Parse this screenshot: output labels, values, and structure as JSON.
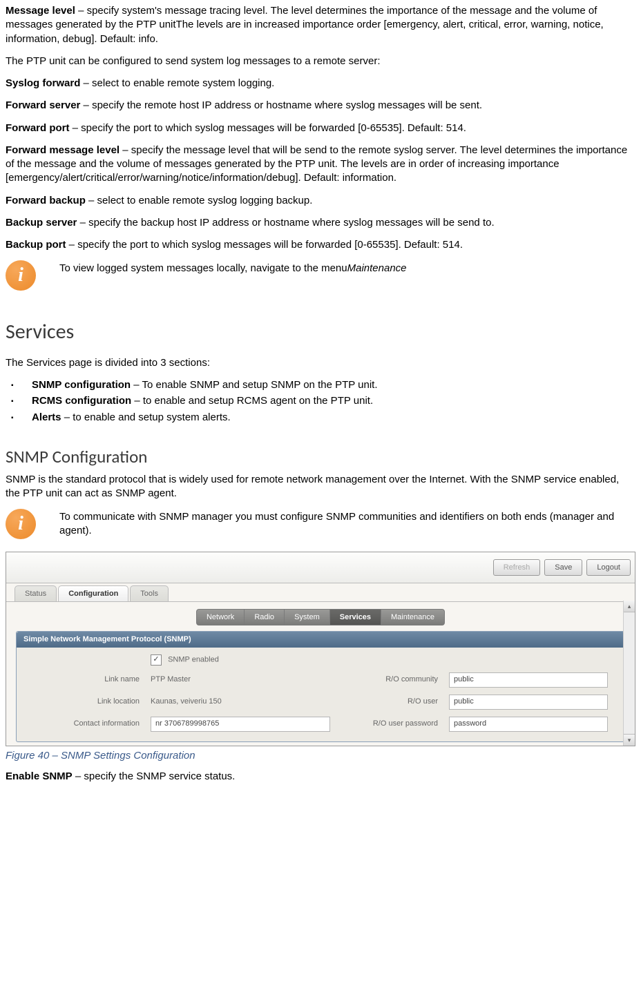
{
  "p1": {
    "label": "Message level",
    "text": " – specify system's message tracing level. The level determines the importance of the message and the volume of messages generated by the PTP unitThe levels are in increased importance order [emergency, alert, critical, error, warning, notice, information, debug]. Default: info."
  },
  "p2": "The PTP unit can be configured to send system log messages to a remote server:",
  "p3": {
    "label": "Syslog forward",
    "text": " – select to enable remote system logging."
  },
  "p4": {
    "label": "Forward server",
    "text": " – specify the remote host IP address or hostname where syslog messages will be sent."
  },
  "p5": {
    "label": "Forward port",
    "text": " – specify the port to which syslog messages will be forwarded [0-65535]. Default: 514."
  },
  "p6": {
    "label": "Forward message level",
    "text": " – specify the message level that will be send to the remote syslog server. The level determines the importance of the message and the volume of messages generated by the PTP unit. The levels are in order of increasing importance [emergency/alert/critical/error/warning/notice/information/debug]. Default: information."
  },
  "p7": {
    "label": "Forward backup",
    "text": " – select to enable remote syslog logging backup."
  },
  "p8": {
    "label": "Backup server",
    "text": " – specify the backup host IP address or hostname where syslog messages will be send to."
  },
  "p9": {
    "label": "Backup port",
    "text": " – specify the port to which syslog messages will be forwarded [0-65535]. Default: 514."
  },
  "info1": {
    "pre": "To view logged system messages locally, navigate to the menu",
    "ital": "Maintenance"
  },
  "services_heading": "Services",
  "services_intro": "The Services page is divided into 3 sections:",
  "bullets": [
    {
      "label": "SNMP configuration",
      "text": " – To enable SNMP and setup SNMP on the PTP unit."
    },
    {
      "label": "RCMS configuration",
      "text": " – to enable and setup RCMS agent on the PTP unit."
    },
    {
      "label": "Alerts",
      "text": " – to enable and setup system alerts."
    }
  ],
  "snmp_heading": "SNMP Configuration",
  "snmp_intro": "SNMP is the standard protocol that is widely used for remote network management over the Internet. With the SNMP service enabled, the PTP unit can act as SNMP agent.",
  "info2": "To communicate with SNMP manager you must configure SNMP communities and identifiers on both ends (manager and agent).",
  "shot": {
    "buttons": {
      "refresh": "Refresh",
      "save": "Save",
      "logout": "Logout"
    },
    "tabs": {
      "status": "Status",
      "config": "Configuration",
      "tools": "Tools"
    },
    "subtabs": {
      "network": "Network",
      "radio": "Radio",
      "system": "System",
      "services": "Services",
      "maintenance": "Maintenance"
    },
    "panel_title": "Simple Network Management Protocol (SNMP)",
    "enabled_label": "SNMP enabled",
    "rows": {
      "link_name": {
        "label": "Link name",
        "value": "PTP Master"
      },
      "link_location": {
        "label": "Link location",
        "value": "Kaunas, veiveriu 150"
      },
      "contact": {
        "label": "Contact information",
        "value": "nr 3706789998765"
      },
      "ro_comm": {
        "label": "R/O community",
        "value": "public"
      },
      "ro_user": {
        "label": "R/O user",
        "value": "public"
      },
      "ro_pass": {
        "label": "R/O user password",
        "value": "password"
      }
    }
  },
  "fig_caption": "Figure 40 – SNMP Settings Configuration",
  "p_last": {
    "label": "Enable SNMP",
    "text": " – specify the SNMP service status."
  }
}
